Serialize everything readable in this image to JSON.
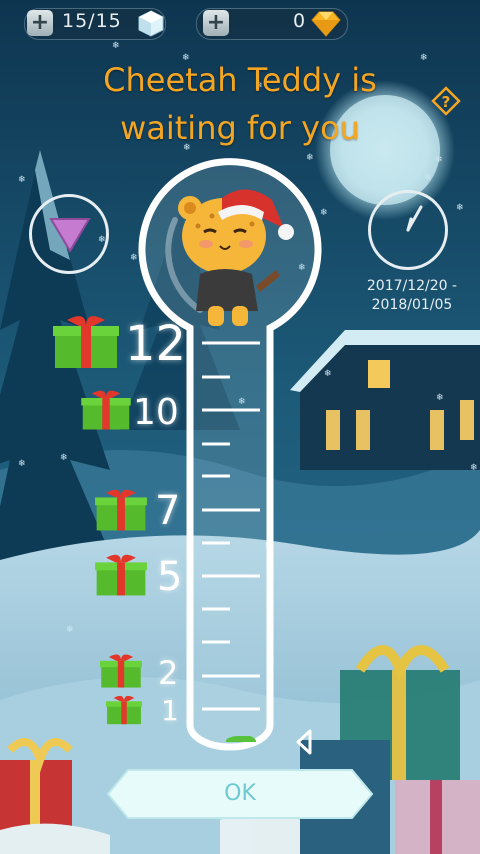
{
  "header": {
    "energy_count": "15/15",
    "gems_count": "0"
  },
  "title_line1": "Cheetah Teddy is",
  "title_line2": "waiting for you",
  "event_dates": {
    "start": "2017/12/20 -",
    "end": "2018/01/05"
  },
  "tiers": [
    {
      "label": "12"
    },
    {
      "label": "10"
    },
    {
      "label": "7"
    },
    {
      "label": "5"
    },
    {
      "label": "2"
    },
    {
      "label": "1"
    }
  ],
  "progress_value": 0,
  "ok_label": "OK",
  "icons": {
    "plus": "plus-icon",
    "cube": "ice-cube-icon",
    "gem": "gold-gem-icon",
    "help": "question-diamond-icon",
    "triangle": "pink-triangle-icon",
    "clock": "clock-icon",
    "gift": "gift-box-icon",
    "pointer": "triangle-pointer-icon"
  },
  "colors": {
    "title": "#f4a623",
    "ok_text": "#6fc9d2",
    "ok_bg": "#e8fbfb",
    "triangle": "#c47bd0"
  }
}
